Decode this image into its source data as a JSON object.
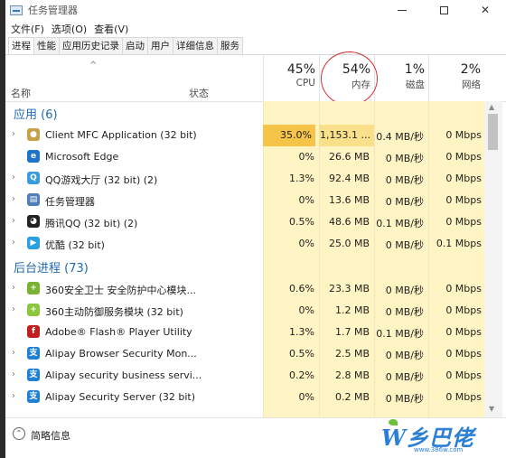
{
  "window": {
    "title": "任务管理器",
    "controls": {
      "minimize": "—",
      "maximize": "□",
      "close": "✕"
    }
  },
  "menubar": [
    "文件(F)",
    "选项(O)",
    "查看(V)"
  ],
  "tabs": [
    "进程",
    "性能",
    "应用历史记录",
    "启动",
    "用户",
    "详细信息",
    "服务"
  ],
  "active_tab_index": 0,
  "columns": {
    "name": "名称",
    "status": "状态",
    "cpu": {
      "percent": "45%",
      "label": "CPU"
    },
    "memory": {
      "percent": "54%",
      "label": "内存"
    },
    "disk": {
      "percent": "1%",
      "label": "磁盘"
    },
    "network": {
      "percent": "2%",
      "label": "网络"
    }
  },
  "groups": [
    {
      "title": "应用 (6)",
      "rows": [
        {
          "name": "Client MFC Application (32 bit)",
          "cpu": "35.0%",
          "memory": "1,153.1 ...",
          "disk": "0.4 MB/秒",
          "network": "0 Mbps",
          "icon": "client-mfc-icon",
          "expandable": true
        },
        {
          "name": "Microsoft Edge",
          "cpu": "0%",
          "memory": "26.6 MB",
          "disk": "0 MB/秒",
          "network": "0 Mbps",
          "icon": "edge-icon",
          "expandable": false
        },
        {
          "name": "QQ游戏大厅 (32 bit) (2)",
          "cpu": "1.3%",
          "memory": "92.4 MB",
          "disk": "0 MB/秒",
          "network": "0 Mbps",
          "icon": "qq-game-icon",
          "expandable": true
        },
        {
          "name": "任务管理器",
          "cpu": "0%",
          "memory": "13.6 MB",
          "disk": "0 MB/秒",
          "network": "0 Mbps",
          "icon": "task-manager-icon",
          "expandable": true
        },
        {
          "name": "腾讯QQ (32 bit) (2)",
          "cpu": "0.5%",
          "memory": "48.6 MB",
          "disk": "0.1 MB/秒",
          "network": "0 Mbps",
          "icon": "qq-penguin-icon",
          "expandable": true
        },
        {
          "name": "优酷 (32 bit)",
          "cpu": "0%",
          "memory": "25.0 MB",
          "disk": "0 MB/秒",
          "network": "0.1 Mbps",
          "icon": "youku-icon",
          "expandable": true
        }
      ]
    },
    {
      "title": "后台进程 (73)",
      "rows": [
        {
          "name": "360安全卫士 安全防护中心模块...",
          "cpu": "0.6%",
          "memory": "23.3 MB",
          "disk": "0 MB/秒",
          "network": "0 Mbps",
          "icon": "360-safe-icon",
          "expandable": true
        },
        {
          "name": "360主动防御服务模块 (32 bit)",
          "cpu": "0%",
          "memory": "1.2 MB",
          "disk": "0 MB/秒",
          "network": "0 Mbps",
          "icon": "360-defense-icon",
          "expandable": true
        },
        {
          "name": "Adobe® Flash® Player Utility",
          "cpu": "1.3%",
          "memory": "1.7 MB",
          "disk": "0.1 MB/秒",
          "network": "0 Mbps",
          "icon": "flash-icon",
          "expandable": false
        },
        {
          "name": "Alipay Browser Security Mon...",
          "cpu": "0.5%",
          "memory": "2.5 MB",
          "disk": "0 MB/秒",
          "network": "0 Mbps",
          "icon": "alipay-icon",
          "expandable": true
        },
        {
          "name": "Alipay security business servi...",
          "cpu": "0.2%",
          "memory": "2.8 MB",
          "disk": "0 MB/秒",
          "network": "0 Mbps",
          "icon": "alipay-icon",
          "expandable": true
        },
        {
          "name": "Alipay Security Server (32 bit)",
          "cpu": "0%",
          "memory": "0.2 MB",
          "disk": "0 MB/秒",
          "network": "0 Mbps",
          "icon": "alipay-icon",
          "expandable": true
        }
      ]
    }
  ],
  "footer": {
    "label": "简略信息"
  },
  "watermark": {
    "text": "W乡巴佬",
    "url": "www.386w.com"
  },
  "colors": {
    "cpu_high": "#f7c44a",
    "column_tint": "#fff4c4",
    "group_title": "#1f6ab0",
    "annotation_circle": "#d0302e",
    "watermark": "#2b7fd4"
  }
}
